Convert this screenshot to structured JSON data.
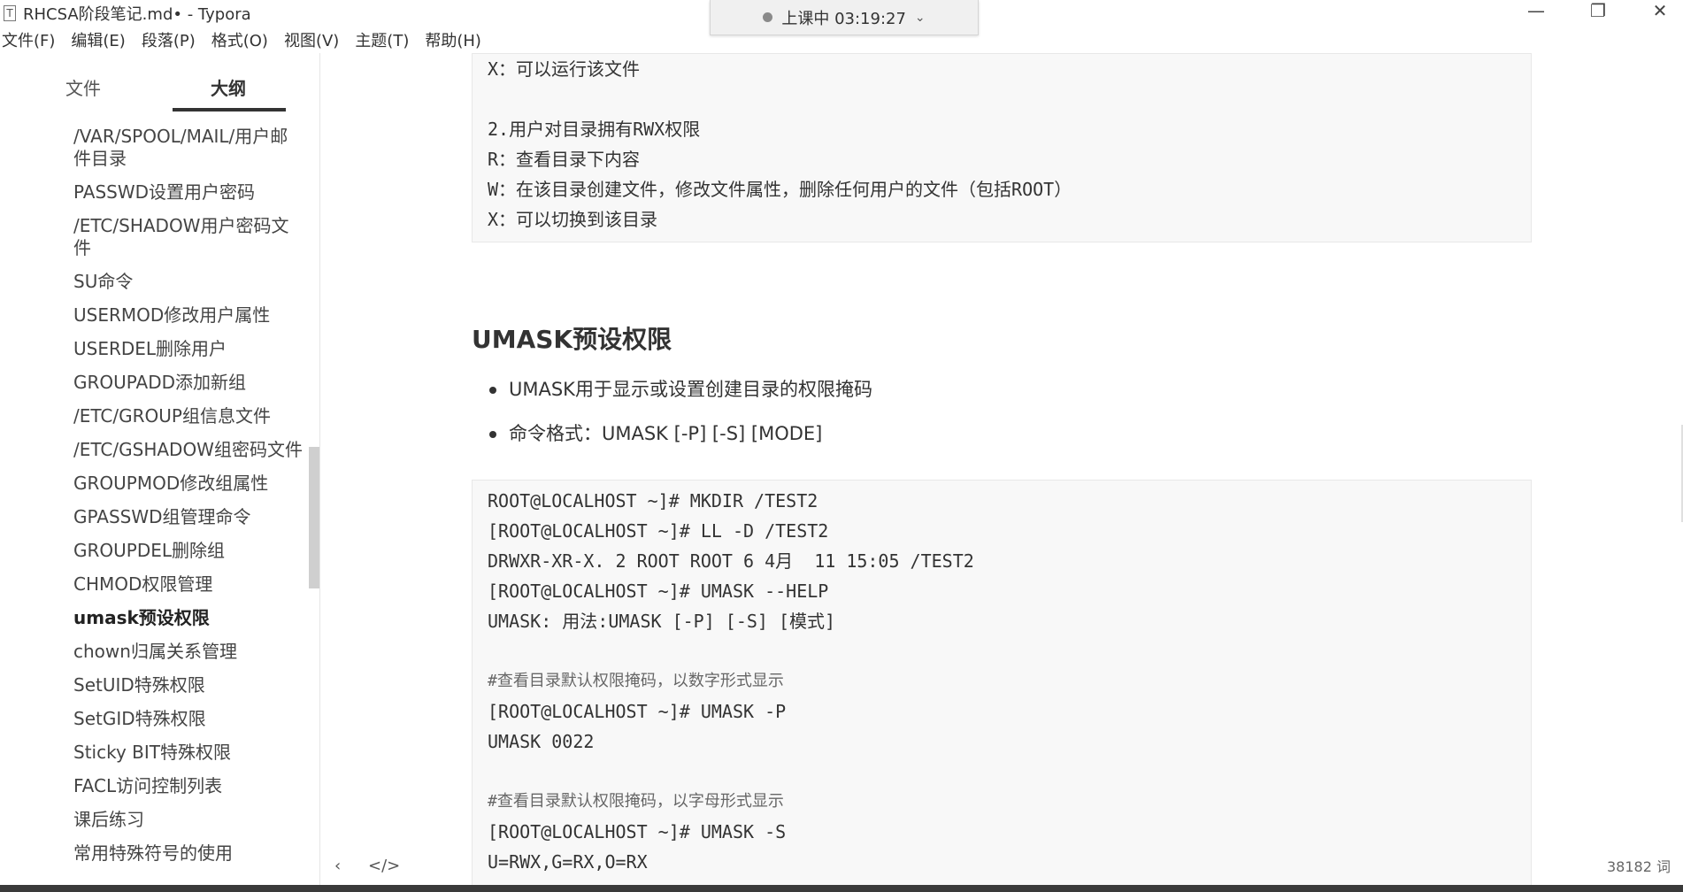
{
  "window": {
    "icon_glyph": "T",
    "title": "RHCSA阶段笔记.md• - Typora",
    "timer": "上课中 03:19:27",
    "chevron": "⌄",
    "minimize": "—",
    "restore": "❐",
    "close": "✕"
  },
  "menu": [
    "文件(F)",
    "编辑(E)",
    "段落(P)",
    "格式(O)",
    "视图(V)",
    "主题(T)",
    "帮助(H)"
  ],
  "sidebar": {
    "tabs": {
      "files": "文件",
      "outline": "大纲"
    },
    "outline": [
      "/VAR/SPOOL/MAIL/用户邮件目录",
      "PASSWD设置用户密码",
      "/ETC/SHADOW用户密码文件",
      "SU命令",
      "USERMOD修改用户属性",
      "USERDEL删除用户",
      "GROUPADD添加新组",
      "/ETC/GROUP组信息文件",
      "/ETC/GSHADOW组密码文件",
      "GROUPMOD修改组属性",
      "GPASSWD组管理命令",
      "GROUPDEL删除组",
      "CHMOD权限管理",
      "umask预设权限",
      "chown归属关系管理",
      "SetUID特殊权限",
      "SetGID特殊权限",
      "Sticky BIT特殊权限",
      "FACL访问控制列表",
      "课后练习",
      "常用特殊符号的使用"
    ],
    "active_index": 13,
    "footer": {
      "back_icon": "‹",
      "source_icon": "</>"
    }
  },
  "editor": {
    "code_block_1": [
      "X：可以运行该文件",
      "",
      "2.用户对目录拥有RWX权限",
      "R：查看目录下内容",
      "W：在该目录创建文件，修改文件属性，删除任何用户的文件（包括ROOT）",
      "X：可以切换到该目录"
    ],
    "heading": "UMASK预设权限",
    "bullets": [
      "UMASK用于显示或设置创建目录的权限掩码",
      "命令格式：UMASK [-P] [-S] [MODE]"
    ],
    "code_block_2": [
      "ROOT@LOCALHOST ~]# MKDIR /TEST2",
      "[ROOT@LOCALHOST ~]# LL -D /TEST2",
      "DRWXR-XR-X. 2 ROOT ROOT 6 4月  11 15:05 /TEST2",
      "[ROOT@LOCALHOST ~]# UMASK --HELP",
      "UMASK: 用法:UMASK [-P] [-S] [模式]",
      "",
      "#查看目录默认权限掩码，以数字形式显示",
      "[ROOT@LOCALHOST ~]# UMASK -P",
      "UMASK 0022",
      "",
      "#查看目录默认权限掩码，以字母形式显示",
      "[ROOT@LOCALHOST ~]# UMASK -S",
      "U=RWX,G=RX,O=RX"
    ],
    "word_count": "38182 词"
  }
}
